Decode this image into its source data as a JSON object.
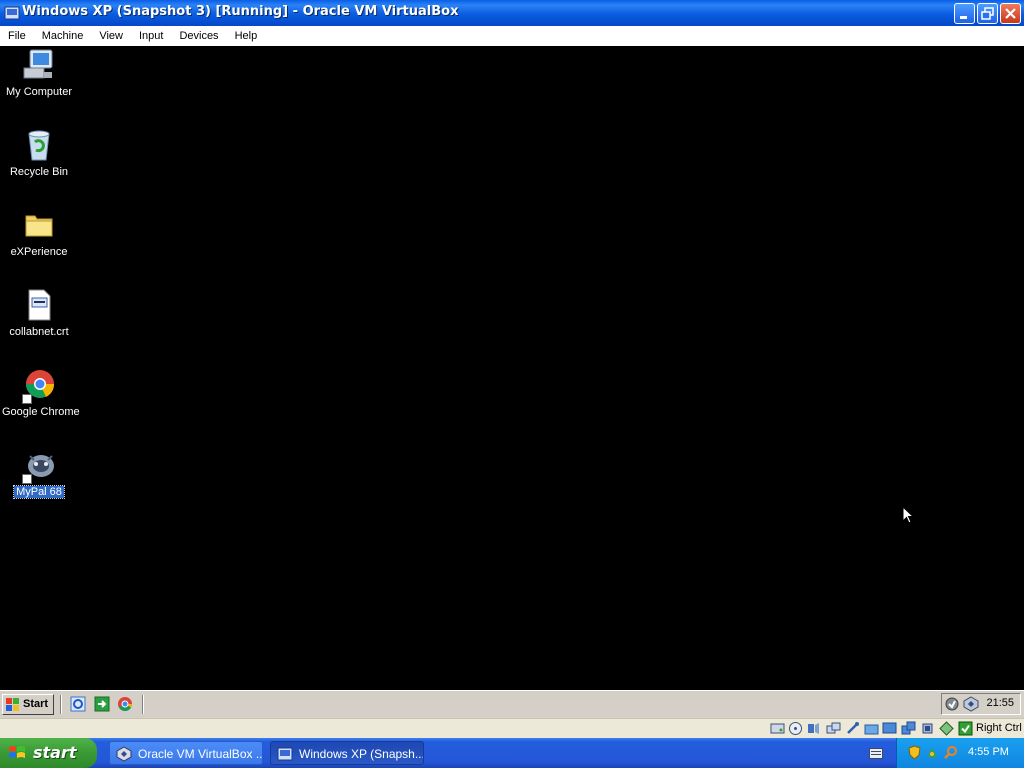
{
  "window": {
    "title": "Windows XP (Snapshot 3) [Running] - Oracle VM VirtualBox"
  },
  "menubar": {
    "items": [
      "File",
      "Machine",
      "View",
      "Input",
      "Devices",
      "Help"
    ]
  },
  "desktop": {
    "icons": [
      {
        "label": "My Computer",
        "icon": "my-computer-icon"
      },
      {
        "label": "Recycle Bin",
        "icon": "recycle-bin-icon"
      },
      {
        "label": "eXPerience",
        "icon": "folder-icon"
      },
      {
        "label": "collabnet.crt",
        "icon": "certificate-file-icon"
      },
      {
        "label": "Google Chrome",
        "icon": "chrome-icon"
      },
      {
        "label": "MyPal 68",
        "icon": "mypal-icon",
        "selected": true
      }
    ]
  },
  "guest_taskbar": {
    "start_label": "Start",
    "quick_launch": [
      "ie-icon",
      "show-desktop-icon",
      "chrome-icon"
    ],
    "clock": "21:55"
  },
  "vbox_status": {
    "icons": [
      "hard-disk-icon",
      "optical-drive-icon",
      "audio-icon",
      "network-icon",
      "usb-icon",
      "shared-folders-icon",
      "display-icon",
      "video-capture-icon",
      "cpu-icon",
      "mouse-integration-icon",
      "keyboard-icon"
    ],
    "host_key": "Right Ctrl"
  },
  "host_taskbar": {
    "start_label": "start",
    "tasks": [
      {
        "label": "Oracle VM VirtualBox ...",
        "icon": "virtualbox-icon",
        "active": false
      },
      {
        "label": "Windows XP (Snapsh...",
        "icon": "vm-windows-icon",
        "active": true
      }
    ],
    "clock": "4:55 PM"
  },
  "colors": {
    "titlebar": "#0a5ce0",
    "host_start": "#3a9a34",
    "desktop_bg": "#000000",
    "selection": "#316ac5"
  }
}
